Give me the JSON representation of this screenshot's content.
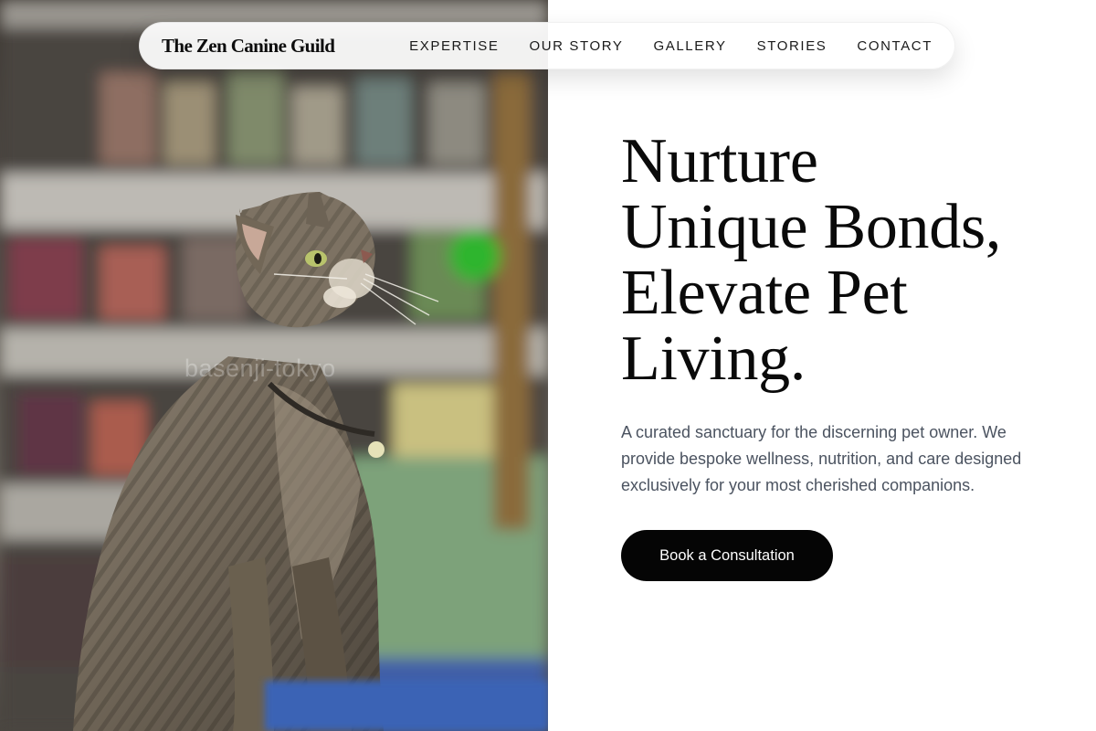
{
  "header": {
    "brand": "The Zen Canine Guild",
    "nav": [
      {
        "label": "EXPERTISE"
      },
      {
        "label": "OUR STORY"
      },
      {
        "label": "GALLERY"
      },
      {
        "label": "STORIES"
      },
      {
        "label": "CONTACT"
      }
    ]
  },
  "hero": {
    "headline_lines": [
      "Nurture",
      "Unique Bonds,",
      "Elevate Pet",
      "Living."
    ],
    "subtitle": "A curated sanctuary for the discerning pet owner. We provide bespoke wellness, nutrition, and care designed exclusively for your most cherished companions.",
    "cta_label": "Book a Consultation"
  },
  "photo": {
    "subject": "tabby cat sitting in a pet store aisle looking up",
    "watermark": "basenji-tokyo"
  },
  "colors": {
    "background": "#ffffff",
    "text_primary": "#0a0a0a",
    "text_secondary": "#4b5360",
    "button_bg": "#050505",
    "button_text": "#ffffff"
  }
}
